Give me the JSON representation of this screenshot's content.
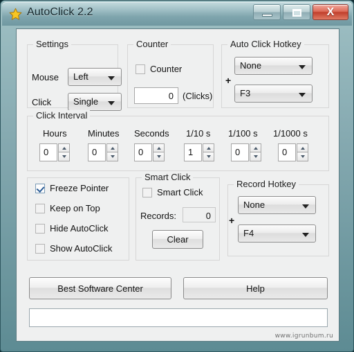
{
  "window": {
    "title": "AutoClick 2.2",
    "icon": "star-icon",
    "minimize_label": "Minimize",
    "maximize_label": "Maximize",
    "close_label": "X",
    "accent_titlebar": "#8fb2b9",
    "accent_close": "#c03f2c",
    "accent_check": "#2b5c97"
  },
  "settings": {
    "title": "Settings",
    "mouse_label": "Mouse",
    "mouse_value": "Left",
    "click_label": "Click",
    "click_value": "Single"
  },
  "counter": {
    "title": "Counter",
    "checkbox_label": "Counter",
    "checkbox_checked": false,
    "value": "0",
    "unit_label": "(Clicks)"
  },
  "auto_click_hotkey": {
    "title": "Auto Click Hotkey",
    "modifier_value": "None",
    "plus": "+",
    "key_value": "F3"
  },
  "click_interval": {
    "title": "Click Interval",
    "fields": [
      {
        "label": "Hours",
        "value": "0"
      },
      {
        "label": "Minutes",
        "value": "0"
      },
      {
        "label": "Seconds",
        "value": "0"
      },
      {
        "label": "1/10 s",
        "value": "1"
      },
      {
        "label": "1/100 s",
        "value": "0"
      },
      {
        "label": "1/1000 s",
        "value": "0"
      }
    ]
  },
  "options": {
    "items": [
      {
        "label": "Freeze Pointer",
        "checked": true
      },
      {
        "label": "Keep on Top",
        "checked": false
      },
      {
        "label": "Hide AutoClick",
        "checked": false
      },
      {
        "label": "Show AutoClick",
        "checked": false
      }
    ]
  },
  "smart_click": {
    "title": "Smart Click",
    "checkbox_label": "Smart Click",
    "checkbox_checked": false,
    "records_label": "Records:",
    "records_value": "0",
    "clear_label": "Clear"
  },
  "record_hotkey": {
    "title": "Record Hotkey",
    "modifier_value": "None",
    "plus": "+",
    "key_value": "F4"
  },
  "footer": {
    "best_software_label": "Best Software Center",
    "help_label": "Help",
    "status_text": "",
    "watermark": "www.igrunbum.ru"
  }
}
